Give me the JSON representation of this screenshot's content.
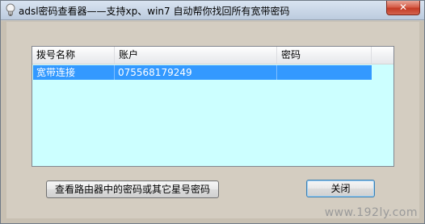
{
  "window": {
    "title": "adsl密码查看器——支持xp、win7 自动帮你找回所有宽带密码",
    "close_label": "✕"
  },
  "listview": {
    "columns": [
      "拨号名称",
      "账户",
      "密码"
    ],
    "rows": [
      {
        "name": "宽带连接",
        "account": "075568179249",
        "password": ""
      }
    ]
  },
  "buttons": {
    "view_router_label": "查看路由器中的密码或其它星号密码",
    "close_label": "关闭"
  },
  "watermark": "www.192ly.com",
  "colors": {
    "selection": "#3399ff",
    "list_background": "#ccffff",
    "client_background": "#d4cdc1"
  }
}
